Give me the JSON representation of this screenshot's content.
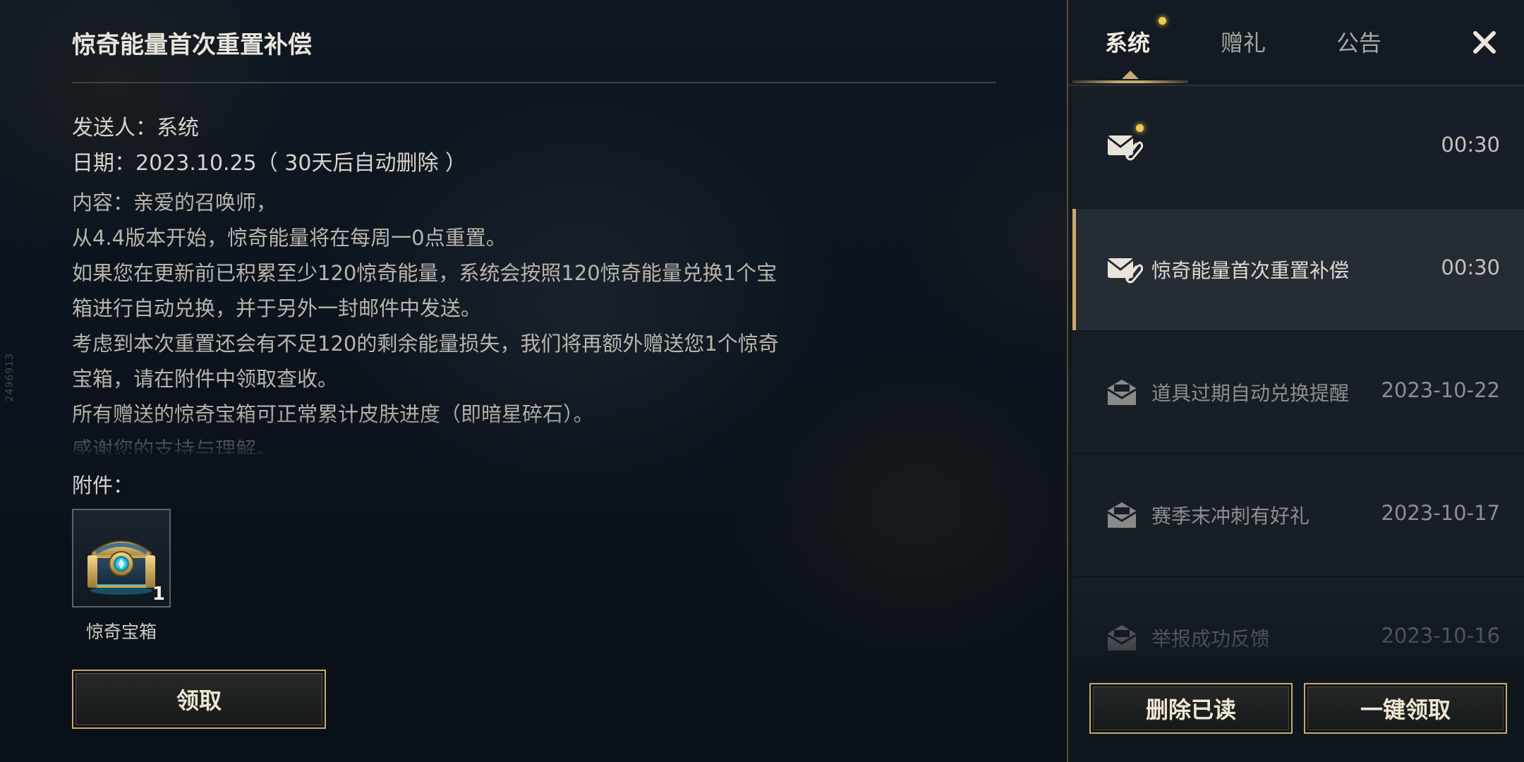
{
  "watermark": "2496913",
  "detail": {
    "title": "惊奇能量首次重置补偿",
    "sender_line": "发送人：系统",
    "date_line": "日期：2023.10.25（ 30天后自动删除 ）",
    "body_lines": [
      "内容：亲爱的召唤师，",
      "从4.4版本开始，惊奇能量将在每周一0点重置。",
      "如果您在更新前已积累至少120惊奇能量，系统会按照120惊奇能量兑换1个宝",
      "箱进行自动兑换，并于另外一封邮件中发送。",
      "考虑到本次重置还会有不足120的剩余能量损失，我们将再额外赠送您1个惊奇",
      "宝箱，请在附件中领取查收。",
      "所有赠送的惊奇宝箱可正常累计皮肤进度（即暗星碎石）。",
      "感谢您的支持与理解。"
    ],
    "attachment_label": "附件：",
    "attachment": {
      "name": "惊奇宝箱",
      "count": "1",
      "icon": "treasure-chest-icon"
    },
    "claim_label": "领取"
  },
  "panel": {
    "tabs": [
      {
        "label": "系统",
        "active": true,
        "has_dot": true
      },
      {
        "label": "赠礼",
        "active": false,
        "has_dot": false
      },
      {
        "label": "公告",
        "active": false,
        "has_dot": false
      }
    ],
    "close_icon": "close-icon",
    "mails": [
      {
        "title": "",
        "time": "00:30",
        "state": "unread",
        "icon": "mail-attachment-icon"
      },
      {
        "title": "惊奇能量首次重置补偿",
        "time": "00:30",
        "state": "selected",
        "icon": "mail-attachment-icon"
      },
      {
        "title": "道具过期自动兑换提醒",
        "time": "2023-10-22",
        "state": "read",
        "icon": "mail-read-icon"
      },
      {
        "title": "赛季末冲刺有好礼",
        "time": "2023-10-17",
        "state": "read",
        "icon": "mail-read-icon"
      },
      {
        "title": "举报成功反馈",
        "time": "2023-10-16",
        "state": "read",
        "icon": "mail-read-icon"
      }
    ],
    "delete_read_label": "删除已读",
    "claim_all_label": "一键领取"
  },
  "colors": {
    "accent_gold": "#c8aa6e",
    "notify_dot": "#f2c94c"
  }
}
